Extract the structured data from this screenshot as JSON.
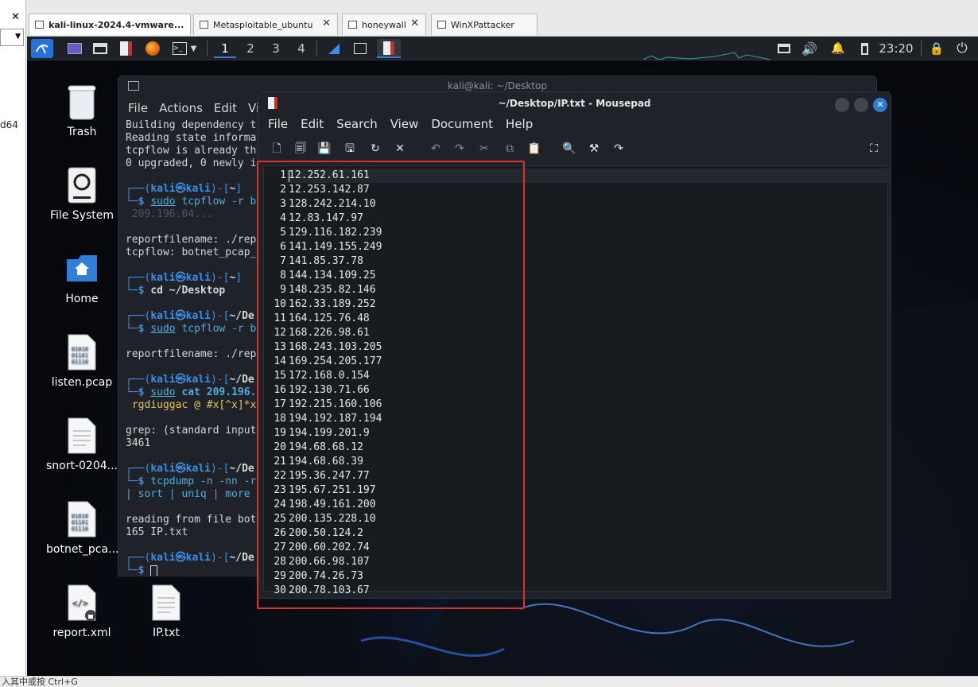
{
  "vm_tabs": [
    {
      "label": "kali-linux-2024.4-vmware...",
      "active": true
    },
    {
      "label": "Metasploitable_ubuntu",
      "active": false
    },
    {
      "label": "honeywall",
      "active": false
    },
    {
      "label": "WinXPattacker",
      "active": false
    }
  ],
  "left_pane": {
    "close_label": "✕",
    "fragment": "d64"
  },
  "status_bar": "入其中或按 Ctrl+G",
  "panel": {
    "workspaces": [
      "1",
      "2",
      "3",
      "4"
    ],
    "active_workspace": "1",
    "clock": "23:20"
  },
  "desktop_icons": [
    {
      "label": "Trash",
      "icon": "trash-icon"
    },
    {
      "label": "File System",
      "icon": "drive-icon"
    },
    {
      "label": "Home",
      "icon": "home-folder-icon"
    },
    {
      "label": "listen.pcap",
      "icon": "binary-file-icon"
    },
    {
      "label": "snort-0204...",
      "icon": "text-file-icon"
    },
    {
      "label": "botnet_pca...",
      "icon": "binary-file-icon"
    },
    {
      "label": "report.xml",
      "icon": "xml-file-icon"
    },
    {
      "label": "IP.txt",
      "icon": "text-file-icon"
    }
  ],
  "terminal": {
    "title": "kali@kali: ~/Desktop",
    "menu": [
      "File",
      "Actions",
      "Edit",
      "Vi"
    ],
    "lines": {
      "l1": "Building dependency t",
      "l2": "Reading state informa",
      "l3": "tcpflow is already th",
      "l4": "0 upgraded, 0 newly i",
      "p1_path": "~",
      "c1_cmd": "sudo",
      "c1_rest": " tcpflow -r b",
      "c1_ghost": " 209.196.04...",
      "o1": "reportfilename: ./rep",
      "o2": "tcpflow: botnet_pcap_",
      "p2_path": "~",
      "c2": "cd ~/Desktop",
      "p3_path": "~/De",
      "c3_cmd": "sudo",
      "c3_rest": " tcpflow -r b",
      "o3": "reportfilename: ./rep",
      "p4_path": "~/De",
      "c4_cmd": "sudo",
      "c4_rest": " cat 209.196.",
      "c4_grep": " rgdiuggac @ #x[^x]*x",
      "o4": "grep: (standard input",
      "o5": "3461",
      "p5_path": "~/De",
      "c5": "tcpdump -n -nn -r",
      "c5_pipe": "| sort | uniq | more",
      "o6": "reading from file bot",
      "o7": "165 IP.txt",
      "p6_path": "~/De",
      "user": "kali",
      "host": "kali",
      "at": "㉿",
      "prompt_sym": "$"
    }
  },
  "mousepad": {
    "title": "~/Desktop/IP.txt - Mousepad",
    "menu": [
      "File",
      "Edit",
      "Search",
      "View",
      "Document",
      "Help"
    ],
    "ip_lines": [
      "12.252.61.161",
      "12.253.142.87",
      "128.242.214.10",
      "12.83.147.97",
      "129.116.182.239",
      "141.149.155.249",
      "141.85.37.78",
      "144.134.109.25",
      "148.235.82.146",
      "162.33.189.252",
      "164.125.76.48",
      "168.226.98.61",
      "168.243.103.205",
      "169.254.205.177",
      "172.168.0.154",
      "192.130.71.66",
      "192.215.160.106",
      "194.192.187.194",
      "194.199.201.9",
      "194.68.68.12",
      "194.68.68.39",
      "195.36.247.77",
      "195.67.251.197",
      "198.49.161.200",
      "200.135.228.10",
      "200.50.124.2",
      "200.60.202.74",
      "200.66.98.107",
      "200.74.26.73",
      "200.78.103.67"
    ]
  },
  "colors": {
    "highlight_box": "#e0302a",
    "kali_blue": "#3b8eea",
    "panel_bg": "#1e2126"
  }
}
